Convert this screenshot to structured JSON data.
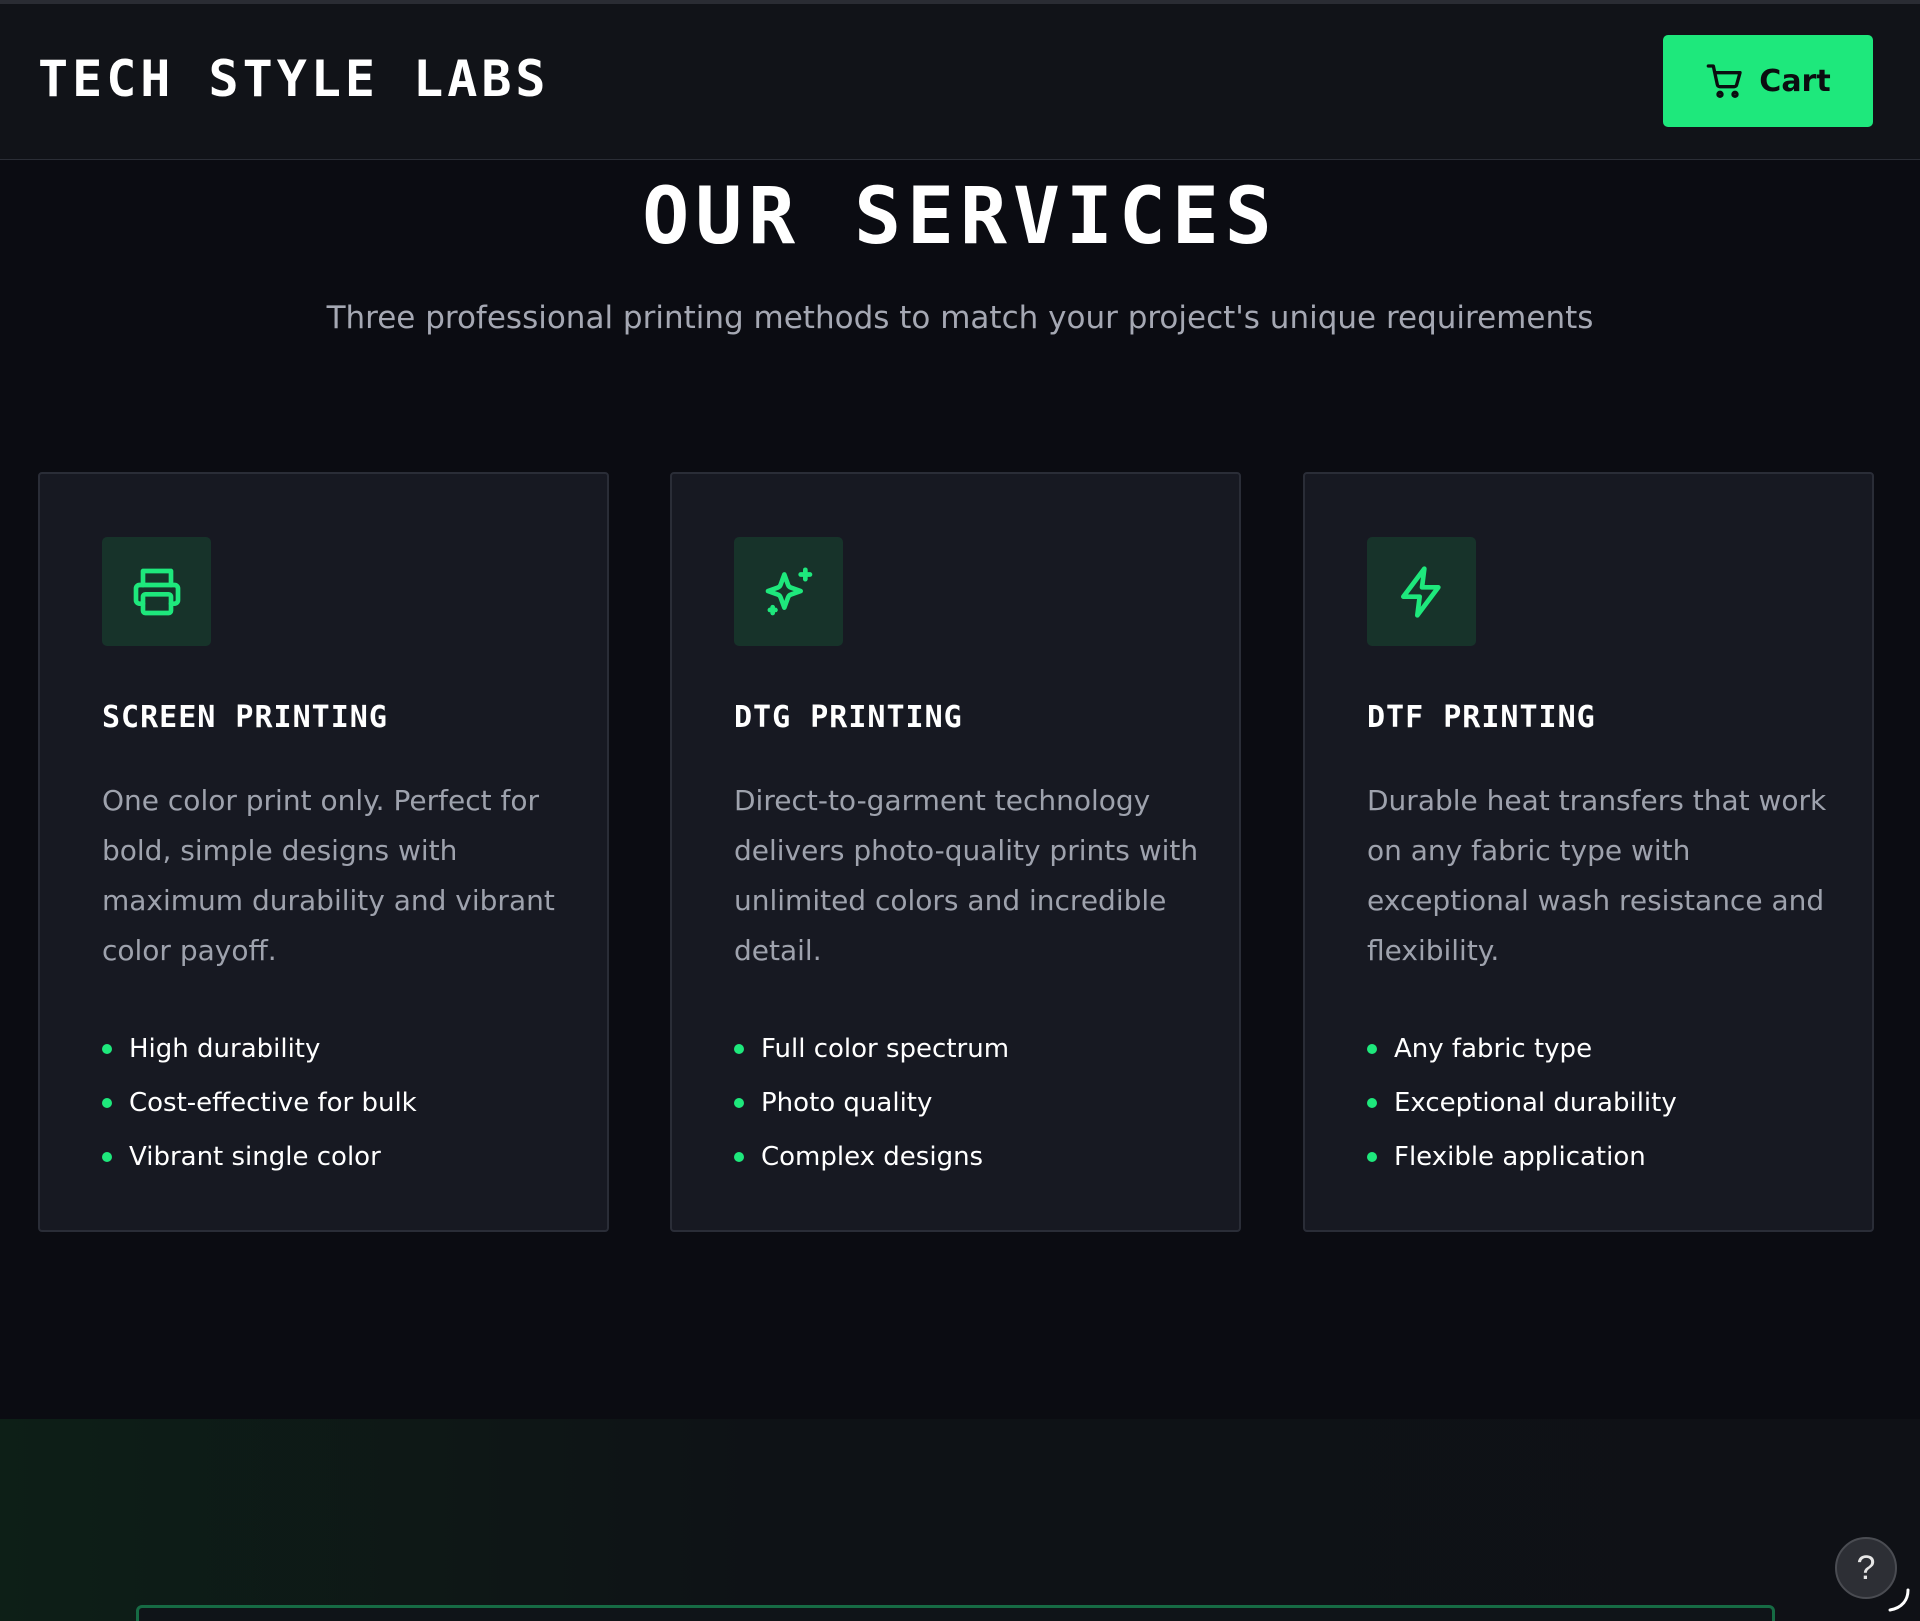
{
  "header": {
    "brand": "TECH STYLE LABS",
    "cart_label": "Cart",
    "cart_icon": "shopping-cart-icon"
  },
  "colors": {
    "accent": "#1ee87c",
    "background": "#0b0c12",
    "card": "#171922",
    "icon_tile": "#17332a"
  },
  "services": {
    "title": "OUR SERVICES",
    "subtitle": "Three professional printing methods to match your project's unique requirements",
    "cards": [
      {
        "icon": "printer-icon",
        "title": "SCREEN PRINTING",
        "description": "One color print only. Perfect for bold, simple designs with maximum durability and vibrant color payoff.",
        "features": [
          "High durability",
          "Cost-effective for bulk",
          "Vibrant single color"
        ]
      },
      {
        "icon": "sparkles-icon",
        "title": "DTG PRINTING",
        "description": "Direct-to-garment technology delivers photo-quality prints with unlimited colors and incredible detail.",
        "features": [
          "Full color spectrum",
          "Photo quality",
          "Complex designs"
        ]
      },
      {
        "icon": "lightning-icon",
        "title": "DTF PRINTING",
        "description": "Durable heat transfers that work on any fabric type with exceptional wash resistance and flexibility.",
        "features": [
          "Any fabric type",
          "Exceptional durability",
          "Flexible application"
        ]
      }
    ]
  },
  "help": {
    "label": "?",
    "icon": "help-icon"
  }
}
